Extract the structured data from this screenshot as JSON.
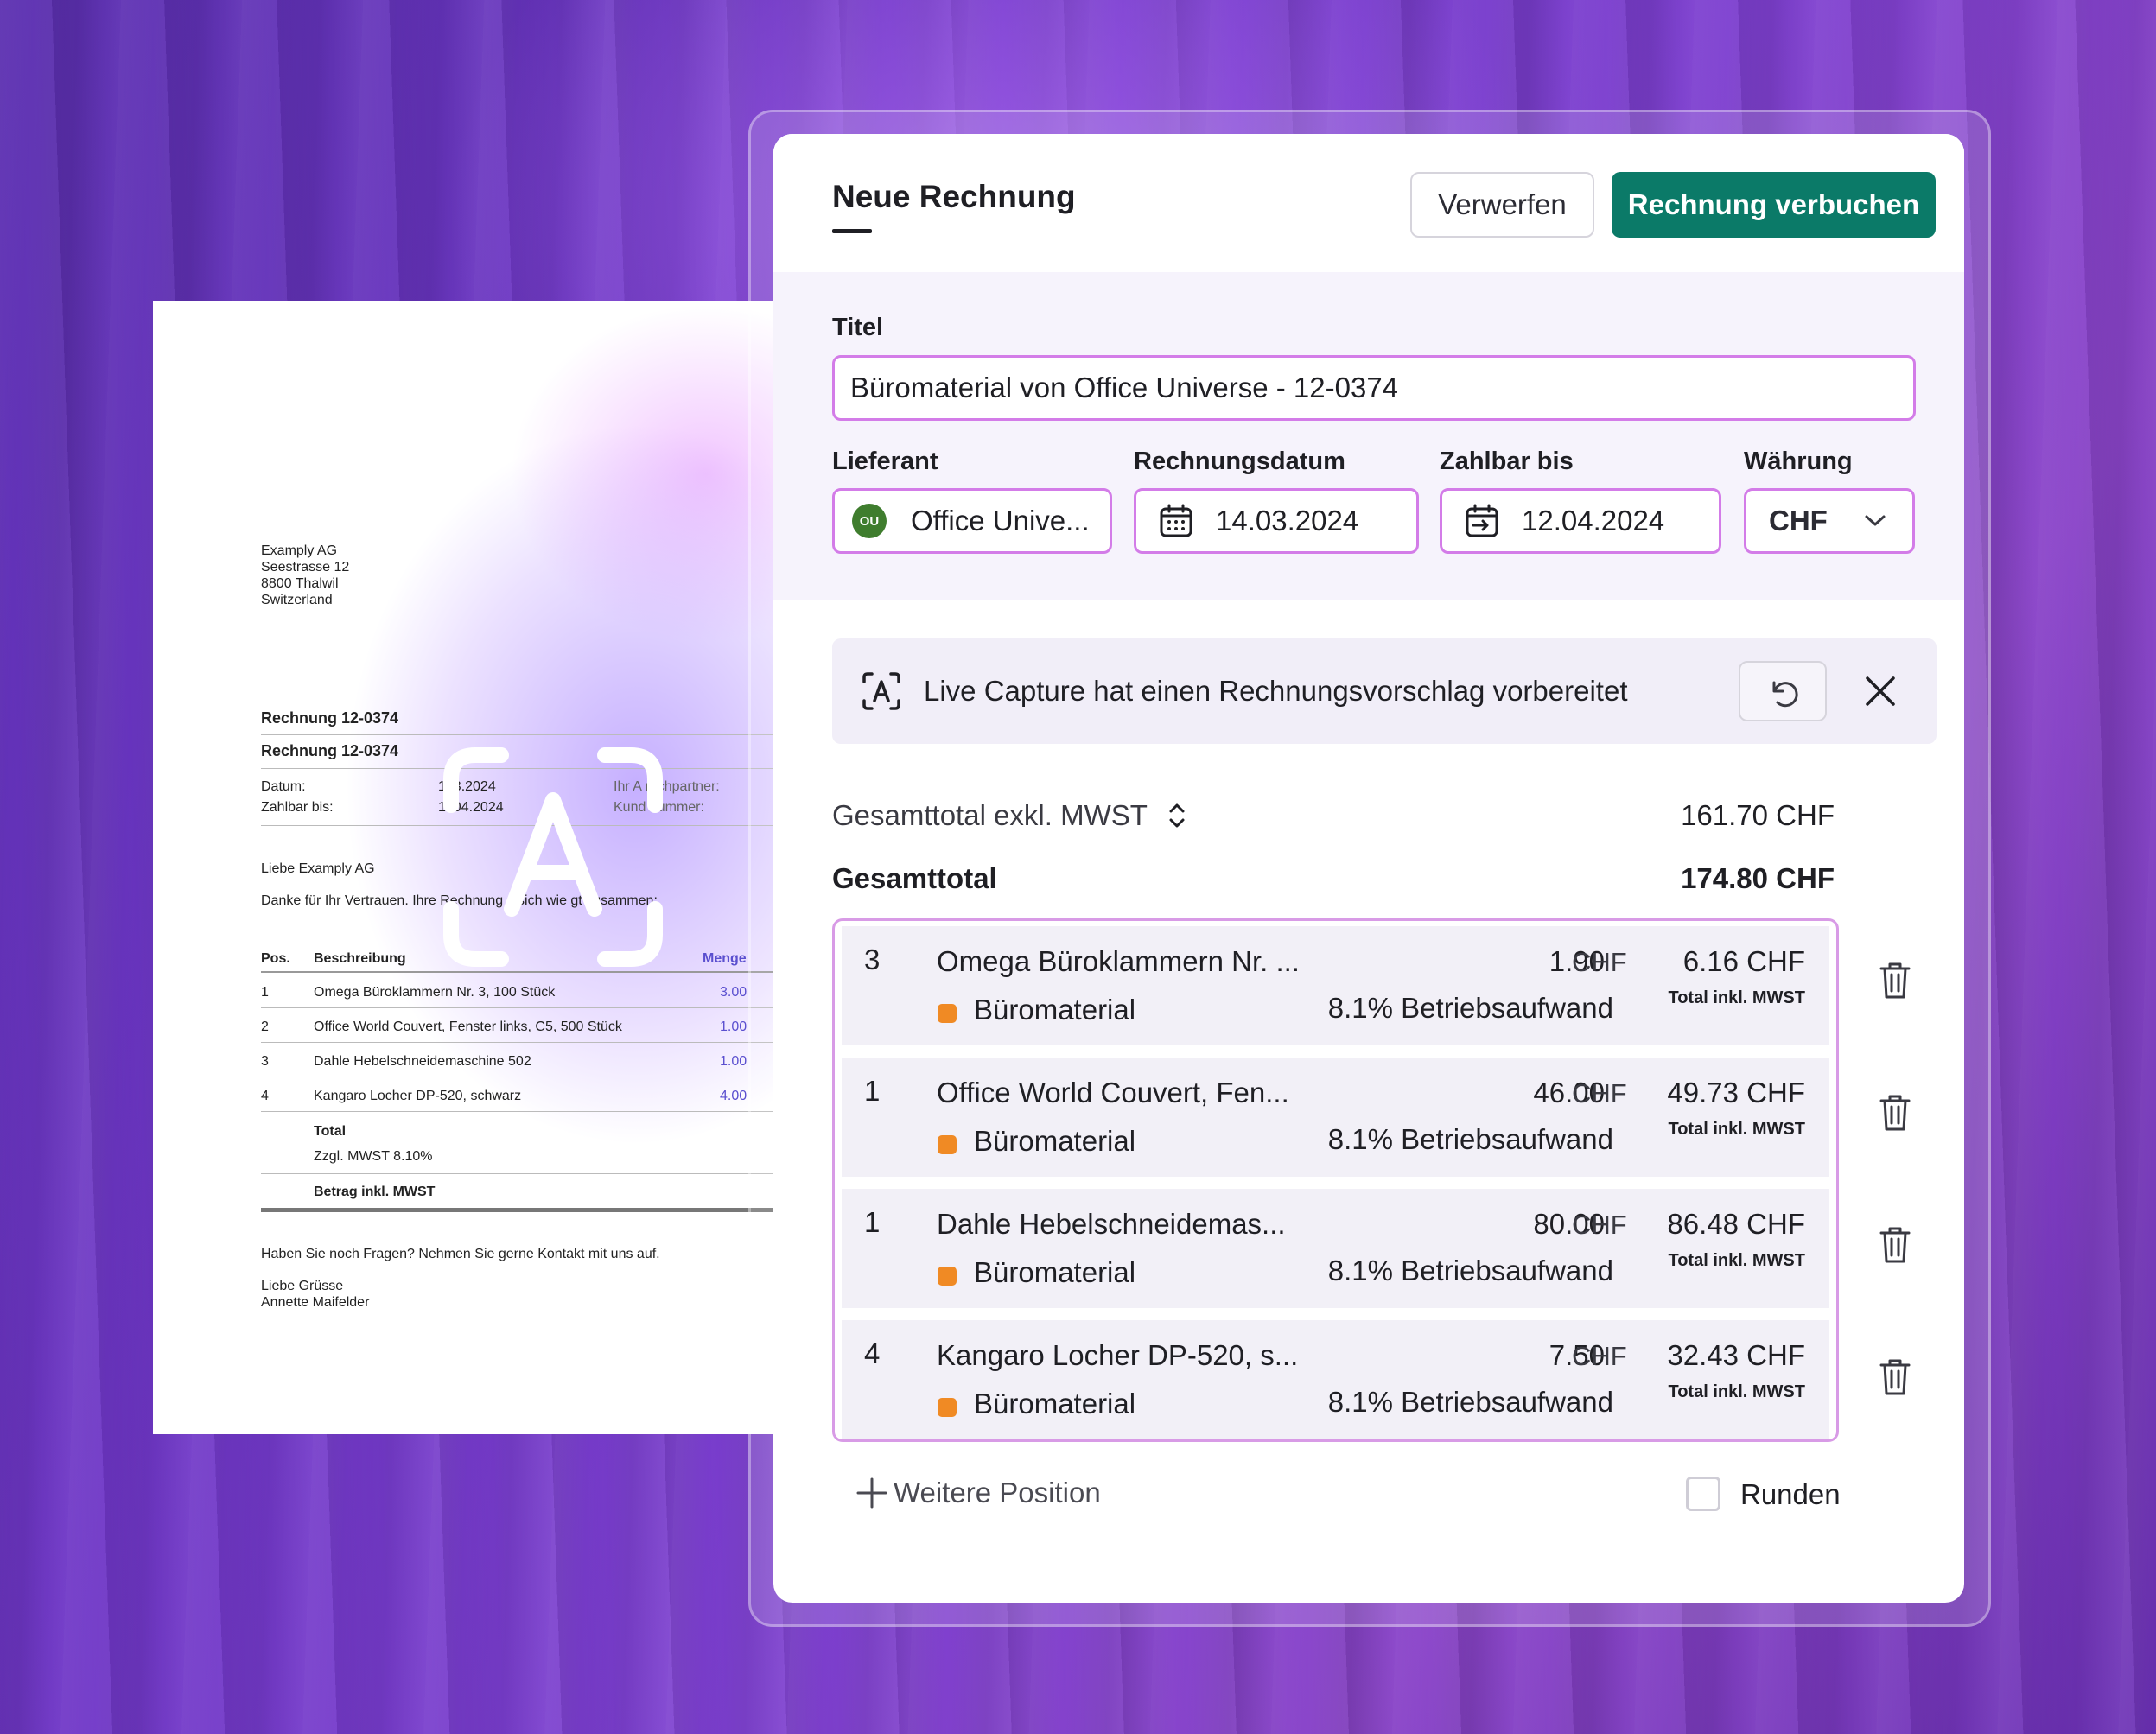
{
  "paper": {
    "sender": [
      "Examply AG",
      "Seestrasse 12",
      "8800 Thalwil",
      "Switzerland"
    ],
    "heading1": "Rechnung 12-0374",
    "heading2": "Rechnung 12-0374",
    "meta": {
      "datum_label": "Datum:",
      "datum_value": "1 .3.2024",
      "zahlbar_label": "Zahlbar bis:",
      "zahlbar_value": "1 .04.2024",
      "contact_label": "Ihr A     rechpartner:",
      "customer_label": "Kund   nummer:"
    },
    "greeting": "Liebe Examply AG",
    "intro": "Danke für Ihr Vertrauen. Ihre Rechnung s    sich wie   gt zusammen:",
    "table_headers": {
      "pos": "Pos.",
      "desc": "Beschreibung",
      "qty": "Menge"
    },
    "rows": [
      {
        "pos": "1",
        "desc": "Omega Büroklammern Nr. 3, 100 Stück",
        "qty": "3.00"
      },
      {
        "pos": "2",
        "desc": "Office World Couvert, Fenster links, C5, 500 Stück",
        "qty": "1.00"
      },
      {
        "pos": "3",
        "desc": "Dahle Hebelschneidemaschine 502",
        "qty": "1.00"
      },
      {
        "pos": "4",
        "desc": "Kangaro Locher DP-520, schwarz",
        "qty": "4.00"
      }
    ],
    "total_label": "Total",
    "vat_label": "Zzgl. MWST 8.10%",
    "amount_label": "Betrag inkl. MWST",
    "questions": "Haben Sie noch Fragen? Nehmen Sie gerne Kontakt mit uns auf.",
    "closing": [
      "Liebe Grüsse",
      "Annette Maifelder"
    ]
  },
  "form": {
    "title": "Neue Rechnung",
    "discard_label": "Verwerfen",
    "book_label": "Rechnung verbuchen",
    "titel_label": "Titel",
    "titel_value": "Büromaterial von Office Universe - 12-0374",
    "lieferant_label": "Lieferant",
    "lieferant_initials": "OU",
    "lieferant_value": "Office Unive...",
    "rechnungsdatum_label": "Rechnungsdatum",
    "rechnungsdatum_value": "14.03.2024",
    "zahlbar_label": "Zahlbar bis",
    "zahlbar_value": "12.04.2024",
    "waehrung_label": "Währung",
    "waehrung_value": "CHF"
  },
  "notice": {
    "message": "Live Capture hat einen Rechnungsvorschlag vorbereitet"
  },
  "summary": {
    "net_label": "Gesamttotal exkl. MWST",
    "net_value": "161.70 CHF",
    "gross_label": "Gesamttotal",
    "gross_value": "174.80 CHF"
  },
  "items": [
    {
      "qty": "3",
      "desc": "Omega Büroklammern Nr. ...",
      "price": "1.90",
      "currency": "CHF",
      "category": "Büromaterial",
      "tax": "8.1% Betriebsaufwand",
      "total": "6.16 CHF",
      "total_note": "Total inkl. MWST"
    },
    {
      "qty": "1",
      "desc": "Office World Couvert, Fen...",
      "price": "46.00",
      "currency": "CHF",
      "category": "Büromaterial",
      "tax": "8.1% Betriebsaufwand",
      "total": "49.73 CHF",
      "total_note": "Total inkl. MWST"
    },
    {
      "qty": "1",
      "desc": "Dahle Hebelschneidemas...",
      "price": "80.00",
      "currency": "CHF",
      "category": "Büromaterial",
      "tax": "8.1% Betriebsaufwand",
      "total": "86.48 CHF",
      "total_note": "Total inkl. MWST"
    },
    {
      "qty": "4",
      "desc": "Kangaro Locher DP-520, s...",
      "price": "7.50",
      "currency": "CHF",
      "category": "Büromaterial",
      "tax": "8.1% Betriebsaufwand",
      "total": "32.43 CHF",
      "total_note": "Total inkl. MWST"
    }
  ],
  "footer": {
    "add_label": "Weitere Position",
    "round_label": "Runden"
  },
  "colors": {
    "accent": "#0b7a68",
    "field_border": "#d37ce8",
    "category_dot": "#f08a24"
  }
}
